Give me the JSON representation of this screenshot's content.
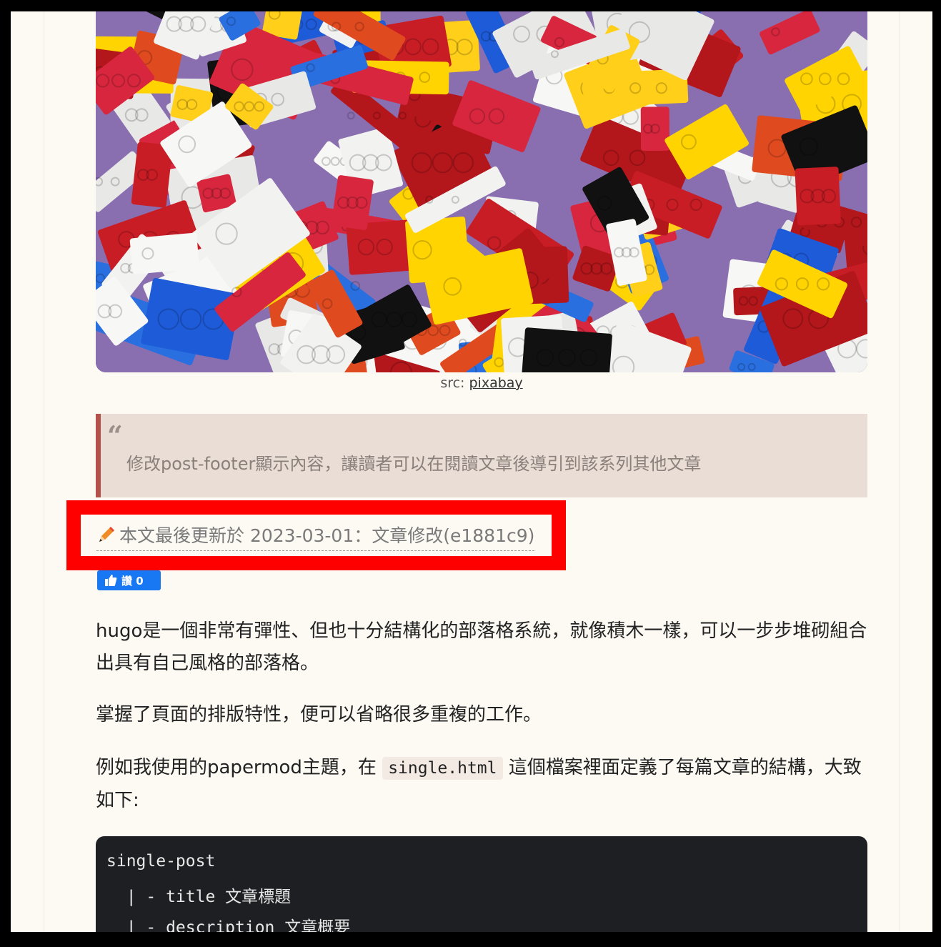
{
  "hero": {
    "caption_prefix": "src: ",
    "caption_link": "pixabay"
  },
  "quote": {
    "mark": "“",
    "text": "修改post-footer顯示內容，讓讀者可以在閱讀文章後導引到該系列其他文章"
  },
  "update": {
    "icon": "pencil-icon",
    "text": "本文最後更新於 2023-03-01：文章修改(e1881c9)"
  },
  "like": {
    "icon": "thumbs-up-icon",
    "label": "讚 0",
    "color": "#1877f2"
  },
  "paragraphs": {
    "p1": "hugo是一個非常有彈性、但也十分結構化的部落格系統，就像積木一樣，可以一步步堆砌組合出具有自己風格的部落格。",
    "p2": "掌握了頁面的排版特性，便可以省略很多重複的工作。",
    "p3_before": "例如我使用的papermod主題，在 ",
    "p3_code": "single.html",
    "p3_after": " 這個檔案裡面定義了每篇文章的結構，大致如下:"
  },
  "code": {
    "line1": "single-post",
    "line2": "  | - title 文章標題",
    "line3": "  | - description 文章概要"
  },
  "colors": {
    "highlight": "#ff0000",
    "quote_border": "#b5514b",
    "page_bg": "#fdf9f3"
  }
}
